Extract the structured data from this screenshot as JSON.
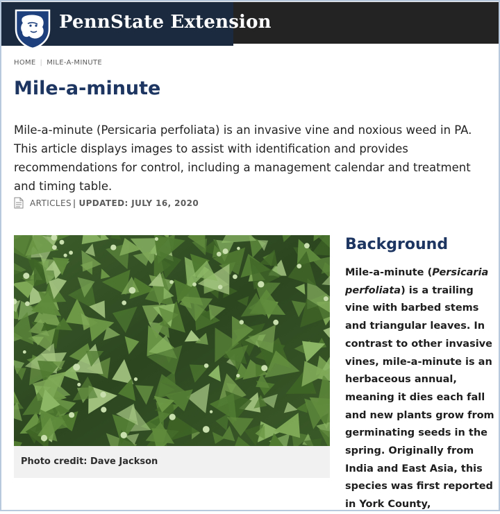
{
  "brand": {
    "name": "PennState Extension"
  },
  "breadcrumb": {
    "home": "HOME",
    "current": "MILE-A-MINUTE"
  },
  "article": {
    "title": "Mile-a-minute",
    "intro": "Mile-a-minute (Persicaria perfoliata) is an invasive vine and noxious weed in PA. This article displays images to assist with identification and provides recommendations for control, including a management calendar and treatment and timing table.",
    "meta": {
      "type": "ARTICLES",
      "updated": "UPDATED: JULY 16, 2020"
    }
  },
  "photo": {
    "caption": "Photo credit: Dave Jackson"
  },
  "background": {
    "heading": "Background",
    "text_before": "Mile-a-minute (",
    "text_italic": "Persicaria perfoliata",
    "text_after": ") is a trailing vine with barbed stems and triangular leaves. In contrast to other invasive vines, mile-a-minute is an herbaceous annual, meaning it dies each fall and new plants grow from germinating seeds in the spring. Originally from India and East Asia, this species was first reported in York County,"
  },
  "colors": {
    "brand_blue": "#1d3661",
    "header_bg": "#232323",
    "caption_bg": "#f1f1f1"
  },
  "icons": {
    "logo": "nittany-lion-shield-icon",
    "article_type": "document-icon"
  }
}
